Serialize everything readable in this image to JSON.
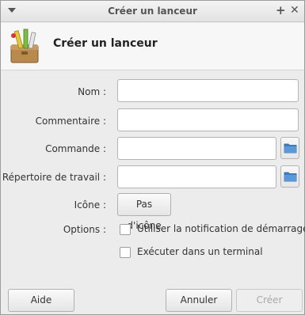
{
  "window": {
    "title": "Créer un lanceur"
  },
  "header": {
    "heading": "Créer un lanceur",
    "icon": "launcher-toolbox-icon"
  },
  "form": {
    "name_label": "Nom :",
    "name_value": "",
    "comment_label": "Commentaire :",
    "comment_value": "",
    "command_label": "Commande :",
    "command_value": "",
    "workdir_label": "Répertoire de travail :",
    "workdir_value": "",
    "icon_label": "Icône :",
    "icon_button": "Pas d'icône",
    "options_label": "Options :",
    "option_startup_notify": "Utiliser la notification de démarrage",
    "option_startup_notify_checked": false,
    "option_terminal": "Exécuter dans un terminal",
    "option_terminal_checked": false
  },
  "buttons": {
    "help": "Aide",
    "cancel": "Annuler",
    "create": "Créer"
  },
  "colors": {
    "window_bg": "#ececec",
    "folder_icon": "#4a86c8"
  }
}
